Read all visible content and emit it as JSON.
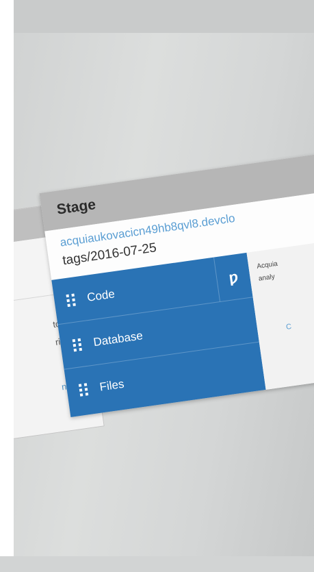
{
  "stage": {
    "title": "Stage",
    "url": "acquiaukovacicn49hb8qvl8.devclo",
    "tag": "tags/2016-07-25",
    "menu": [
      {
        "label": "Code",
        "action": "ƿ"
      },
      {
        "label": "Database"
      },
      {
        "label": "Files"
      }
    ],
    "panel": {
      "text_line1": "Acquia",
      "text_line2": "analy",
      "link": "C"
    }
  },
  "left_card": {
    "line1": "to",
    "line2": "rity",
    "link": "now"
  }
}
